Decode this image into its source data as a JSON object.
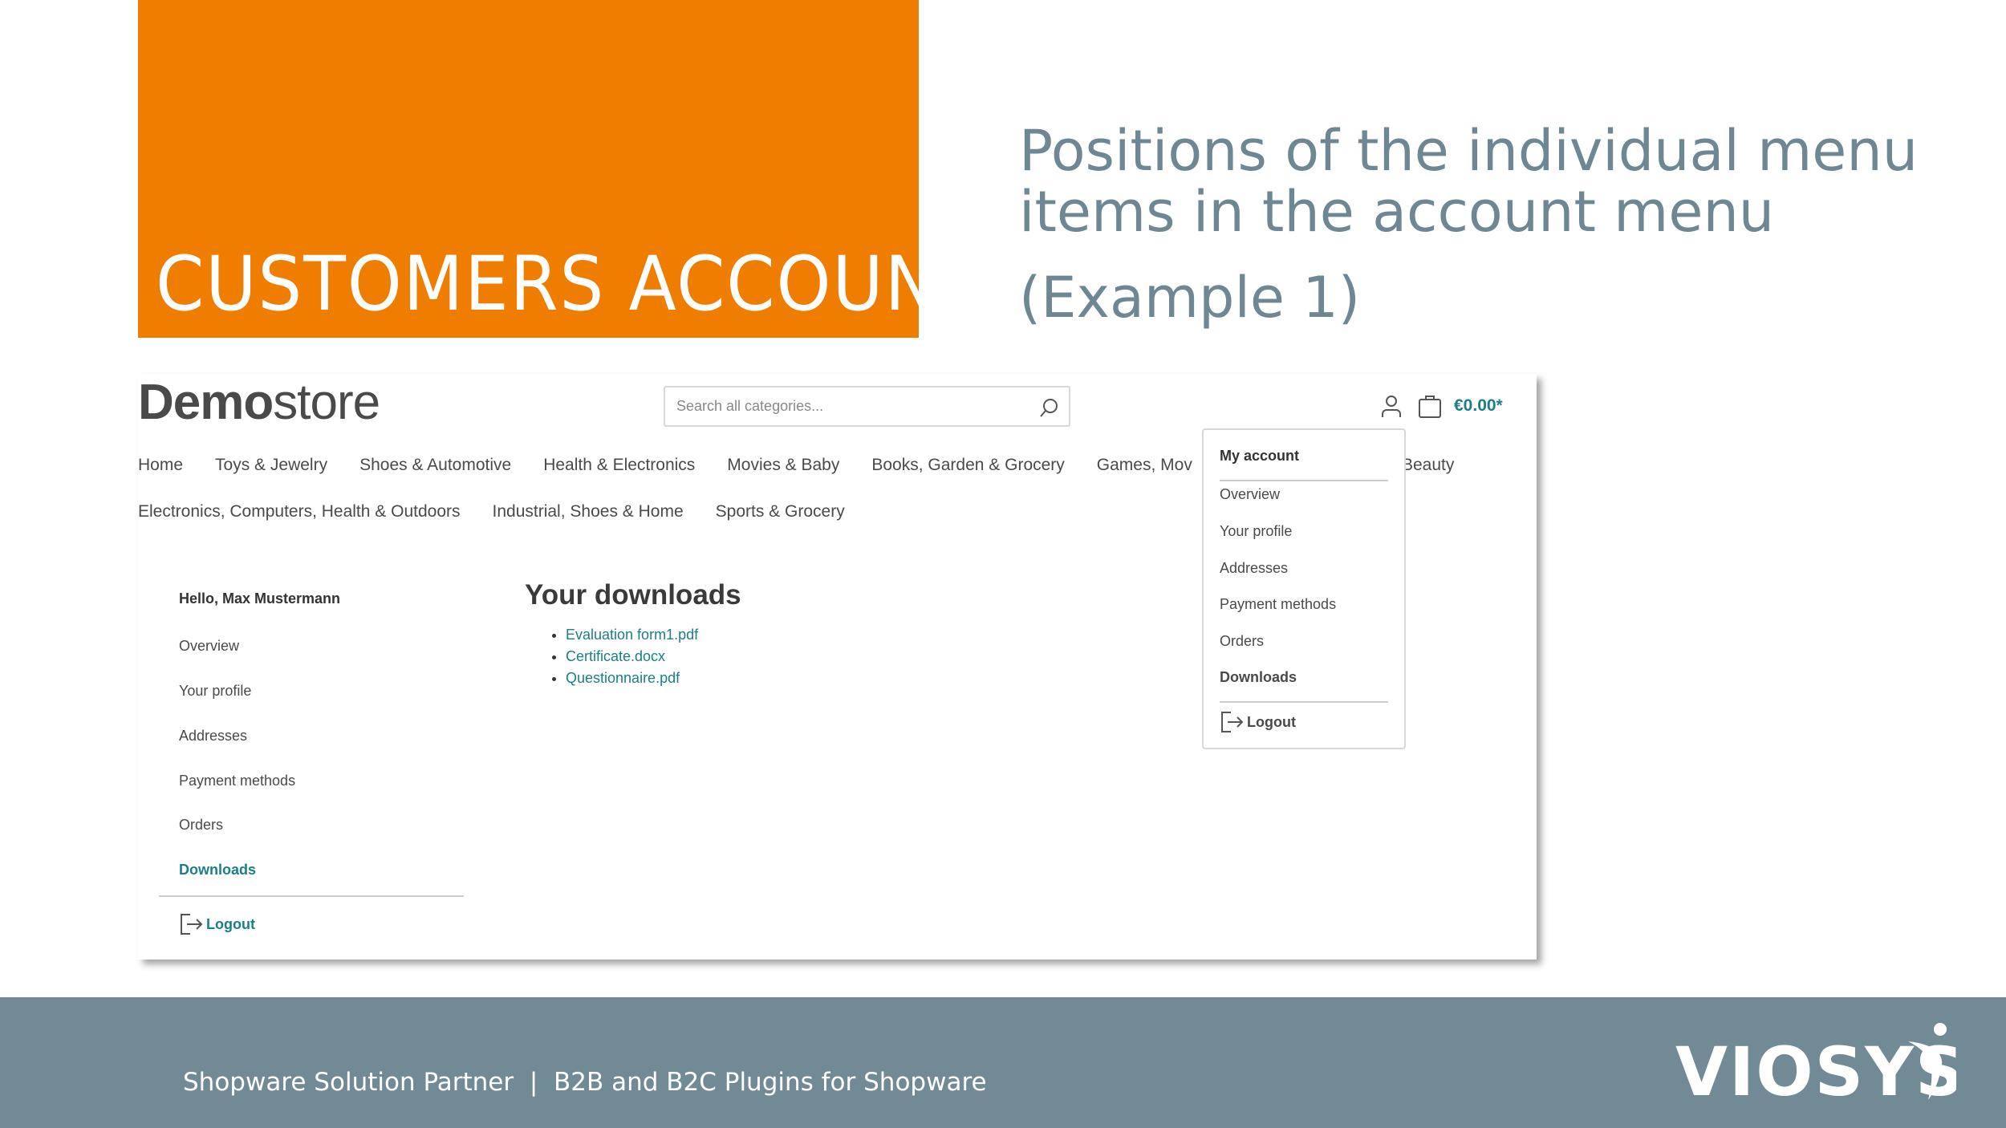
{
  "slide": {
    "section_title": "CUSTOMERS ACCOUNT",
    "heading": "Positions of the individual menu items in the account menu",
    "heading_sub": "(Example 1)",
    "accent_color": "#EE7D00",
    "footer_color": "#728A96"
  },
  "store": {
    "logo_bold": "Demo",
    "logo_light": "store",
    "search_placeholder": "Search all categories...",
    "cart_total": "€0.00*",
    "nav_row1": [
      "Home",
      "Toys & Jewelry",
      "Shoes & Automotive",
      "Health & Electronics",
      "Movies & Baby",
      "Books, Garden & Grocery",
      "Games, Mov",
      "Beauty"
    ],
    "nav_row2": [
      "Electronics, Computers, Health & Outdoors",
      "Industrial, Shoes & Home",
      "Sports & Grocery"
    ]
  },
  "sidebar": {
    "greeting": "Hello, Max Mustermann",
    "items": [
      "Overview",
      "Your profile",
      "Addresses",
      "Payment methods",
      "Orders",
      "Downloads"
    ],
    "logout": "Logout"
  },
  "downloads": {
    "title": "Your downloads",
    "files": [
      "Evaluation form1.pdf",
      "Certificate.docx",
      "Questionnaire.pdf"
    ]
  },
  "dropdown": {
    "title": "My account",
    "items": [
      "Overview",
      "Your profile",
      "Addresses",
      "Payment methods",
      "Orders",
      "Downloads"
    ],
    "logout": "Logout"
  },
  "footer": {
    "text": "Shopware Solution Partner  |  B2B and B2C Plugins for Shopware",
    "brand": "VIOSYS"
  }
}
